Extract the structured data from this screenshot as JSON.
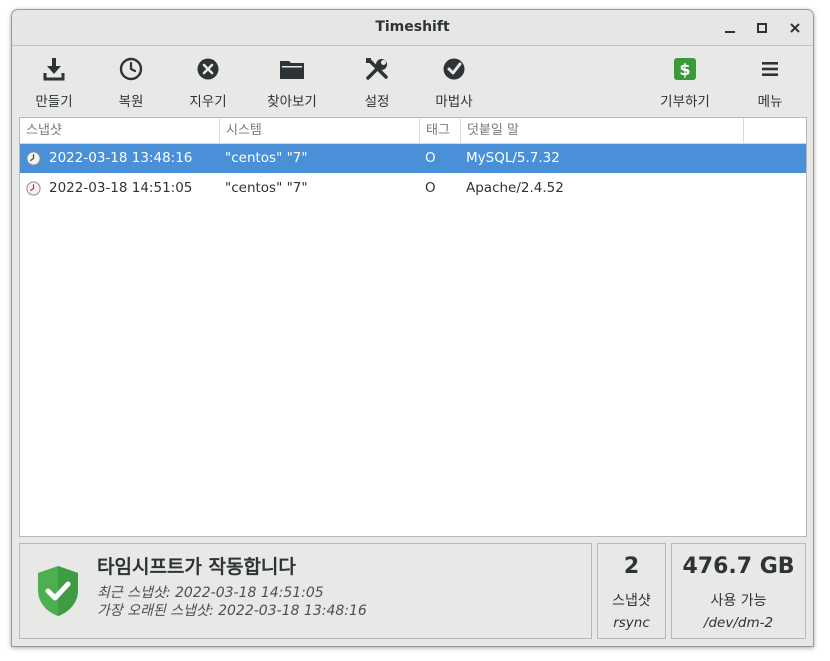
{
  "window": {
    "title": "Timeshift",
    "minimize_glyph": "—",
    "maximize_glyph": "□",
    "close_glyph": "✕"
  },
  "toolbar": {
    "create": "만들기",
    "restore": "복원",
    "delete": "지우기",
    "browse": "찾아보기",
    "settings": "설정",
    "wizard": "마법사",
    "donate": "기부하기",
    "menu": "메뉴"
  },
  "table": {
    "columns": [
      "스냅샷",
      "시스템",
      "태그",
      "덧붙일 말"
    ],
    "rows": [
      {
        "snapshot": "2022-03-18 13:48:16",
        "system": "\"centos\" \"7\"",
        "tag": "O",
        "comment": "MySQL/5.7.32",
        "selected": true
      },
      {
        "snapshot": "2022-03-18 14:51:05",
        "system": "\"centos\" \"7\"",
        "tag": "O",
        "comment": "Apache/2.4.52",
        "selected": false
      }
    ]
  },
  "status": {
    "title": "타임시프트가 작동합니다",
    "latest": "최근 스냅샷: 2022-03-18 14:51:05",
    "oldest": "가장 오래된 스냅샷: 2022-03-18 13:48:16"
  },
  "snapshots": {
    "count": "2",
    "label": "스냅샷",
    "mode": "rsync"
  },
  "disk": {
    "free": "476.7 GB",
    "label": "사용 가능",
    "device": "/dev/dm-2"
  },
  "colors": {
    "selection": "#4a90d9",
    "shield": "#4caf50",
    "donate": "#3a9a3a"
  }
}
